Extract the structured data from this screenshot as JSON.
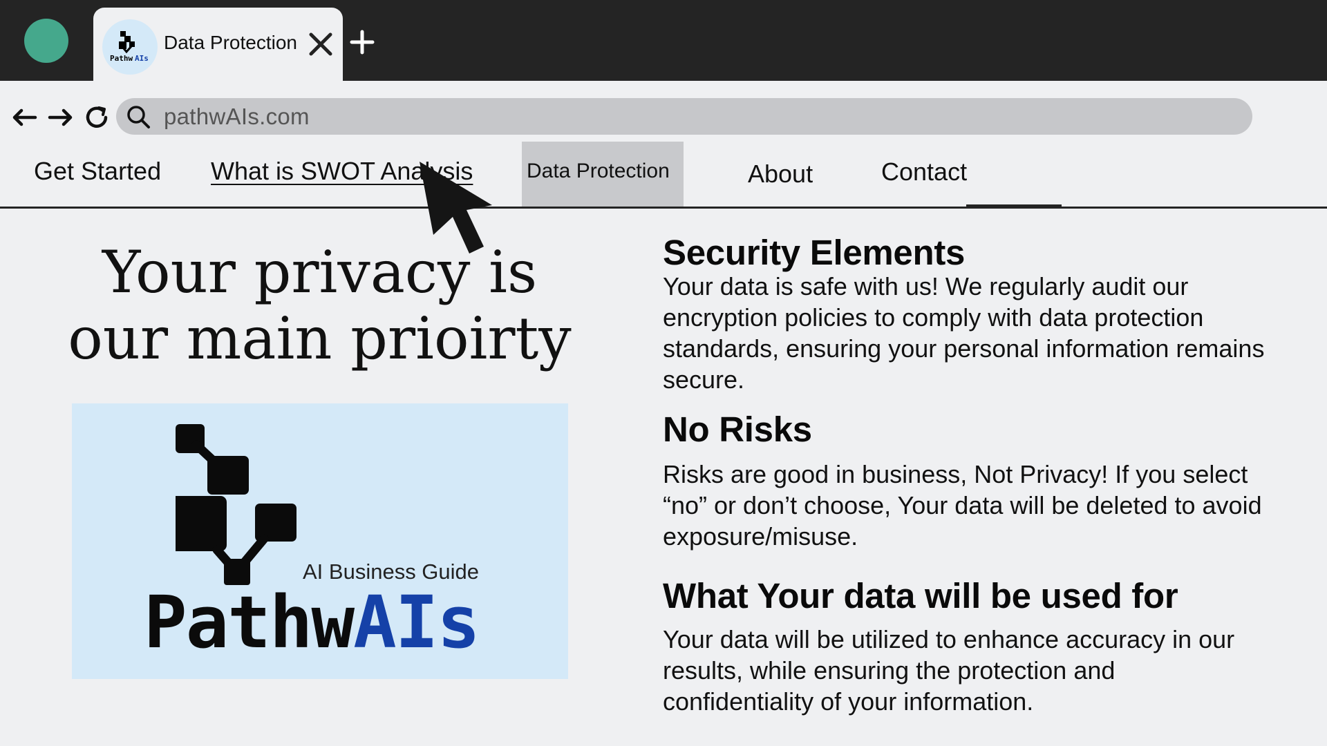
{
  "browser": {
    "tab": {
      "title": "Data Protection",
      "favicon": "pathwais-logo-icon"
    },
    "url": "pathwAIs.com",
    "icons": [
      "back-arrow-icon",
      "forward-arrow-icon",
      "reload-icon",
      "search-icon",
      "close-icon",
      "plus-icon"
    ]
  },
  "nav": {
    "items": [
      {
        "label": "Get Started"
      },
      {
        "label": "What is SWOT Analysis"
      },
      {
        "label": "Data Protection",
        "active": true
      },
      {
        "label": "About"
      },
      {
        "label": "Contact"
      }
    ]
  },
  "hero": {
    "title_line1": "Your privacy is",
    "title_line2": "our main prioirty"
  },
  "logo": {
    "tagline": "AI Business Guide",
    "wordmark_part1": "Pathw",
    "wordmark_part2": "AIs"
  },
  "sections": [
    {
      "heading": "Security Elements",
      "text": "Your data is safe with us! We regularly audit our encryption policies to comply with data protection standards, ensuring your personal information remains secure."
    },
    {
      "heading": "No Risks",
      "text": "Risks are good in business, Not Privacy! If you select “no” or don’t choose, Your data will be deleted to avoid exposure/misuse."
    },
    {
      "heading": "What Your data will be used for",
      "text": "Your data will be utilized to enhance accuracy in our results, while ensuring the protection and confidentiality of your information."
    }
  ],
  "colors": {
    "tabbar": "#242424",
    "page_bg": "#eff0f2",
    "window_dot": "#45a88c",
    "logo_bg": "#d4e9f8",
    "logo_ai_blue": "#1541a8",
    "active_nav_bg": "#c8c9cc"
  }
}
